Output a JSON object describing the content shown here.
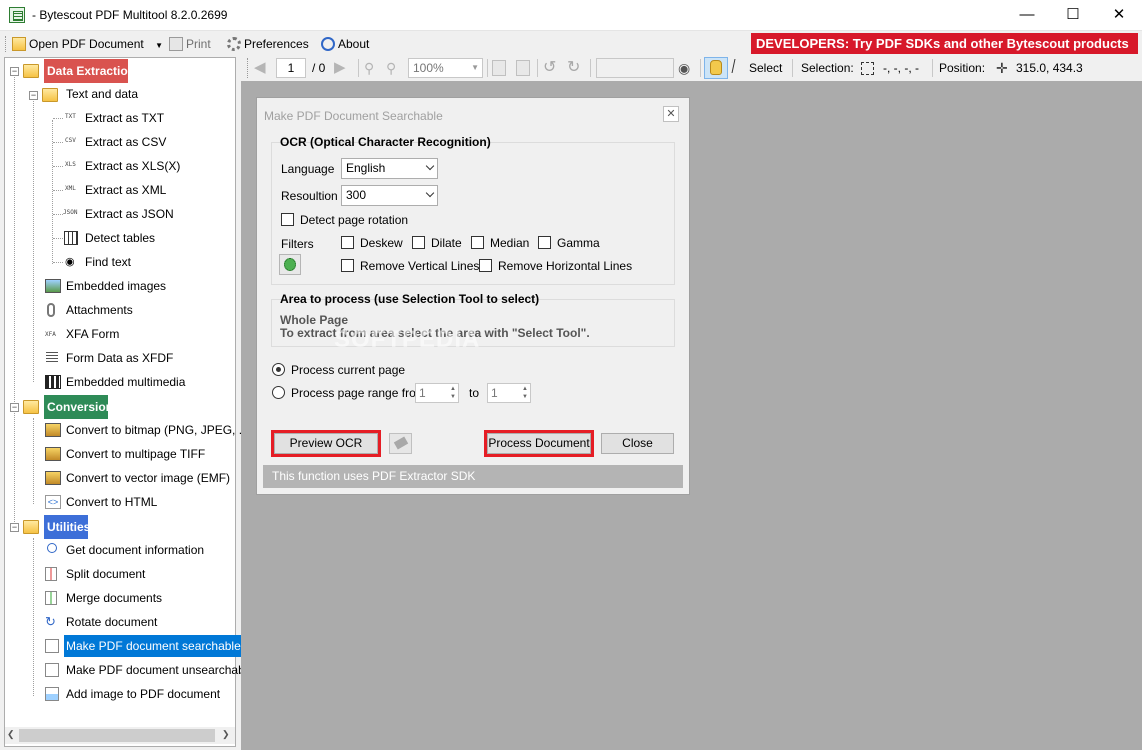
{
  "window": {
    "title": "- Bytescout PDF Multitool 8.2.0.2699"
  },
  "menu": {
    "open": "Open PDF Document",
    "print": "Print",
    "preferences": "Preferences",
    "about": "About",
    "banner": "DEVELOPERS: Try PDF SDKs and other Bytescout products"
  },
  "toolbar": {
    "page_current": "1",
    "page_total": "/ 0",
    "zoom": "100%",
    "select": "Select",
    "selection_label": "Selection:",
    "selection_value": "-, -, -, -",
    "position_label": "Position:",
    "position_value": "315.0, 434.3"
  },
  "tree": {
    "data_extraction": "Data Extraction",
    "text_and_data": "Text and data",
    "extract_txt": "Extract as TXT",
    "extract_csv": "Extract as CSV",
    "extract_xls": "Extract as XLS(X)",
    "extract_xml": "Extract as XML",
    "extract_json": "Extract as JSON",
    "detect_tables": "Detect tables",
    "find_text": "Find text",
    "embedded_images": "Embedded images",
    "attachments": "Attachments",
    "xfa_form": "XFA Form",
    "form_xfdf": "Form Data as XFDF",
    "embedded_multimedia": "Embedded multimedia",
    "conversion": "Conversion",
    "to_bitmap": "Convert to bitmap (PNG, JPEG, ...)",
    "to_tiff": "Convert to multipage TIFF",
    "to_emf": "Convert to vector image (EMF)",
    "to_html": "Convert to HTML",
    "utilities": "Utilities",
    "doc_info": "Get document information",
    "split": "Split document",
    "merge": "Merge documents",
    "rotate": "Rotate document",
    "make_searchable": "Make PDF document searchable",
    "make_unsearchable": "Make PDF document unsearchable",
    "add_image": "Add image to PDF document",
    "tags": {
      "txt": "TXT",
      "csv": "CSV",
      "xls": "XLS",
      "xml": "XML",
      "json": "JSON",
      "xfa": "XFA"
    }
  },
  "colors": {
    "data_extraction": "#d9534f",
    "conversion": "#2e8b57",
    "utilities": "#3d6fd8",
    "selected": "#0078d7"
  },
  "dialog": {
    "title": "Make PDF Document Searchable",
    "ocr_title": "OCR (Optical Character Recognition)",
    "language_label": "Language",
    "language_value": "English",
    "resolution_label": "Resoultion",
    "resolution_value": "300",
    "detect_rotation": "Detect page rotation",
    "filters_label": "Filters",
    "deskew": "Deskew",
    "dilate": "Dilate",
    "median": "Median",
    "gamma": "Gamma",
    "remove_vertical": "Remove Vertical Lines",
    "remove_horizontal": "Remove Horizontal Lines",
    "area_title": "Area to process (use Selection Tool to select)",
    "whole_page": "Whole Page",
    "area_hint": "To extract from area select the area with \"Select Tool\".",
    "process_current": "Process current page",
    "process_range": "Process page range from",
    "range_from": "1",
    "range_to_label": "to",
    "range_to": "1",
    "preview_ocr": "Preview OCR",
    "process_document": "Process Document",
    "close": "Close",
    "footer": "This function uses PDF Extractor SDK"
  },
  "watermark": "SOFTPEDIA"
}
